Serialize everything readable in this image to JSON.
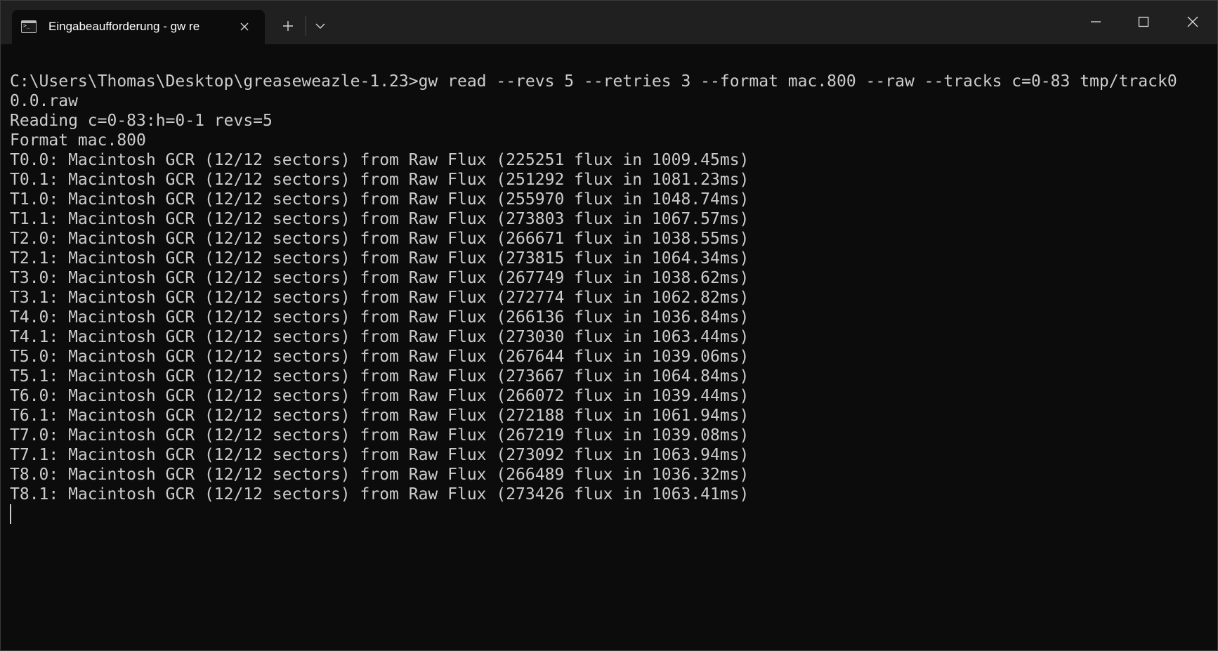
{
  "tab": {
    "title": "Eingabeaufforderung - gw  re",
    "icon": "command-prompt-icon",
    "close_icon": "close-icon"
  },
  "toolbar": {
    "new_tab_label": "+",
    "new_tab_icon": "plus-icon",
    "dropdown_icon": "chevron-down-icon"
  },
  "window_controls": {
    "minimize_icon": "minimize-icon",
    "maximize_icon": "maximize-icon",
    "close_icon": "close-icon"
  },
  "terminal": {
    "lines": [
      "C:\\Users\\Thomas\\Desktop\\greaseweazle-1.23>gw read --revs 5 --retries 3 --format mac.800 --raw --tracks c=0-83 tmp/track0",
      "0.0.raw",
      "Reading c=0-83:h=0-1 revs=5",
      "Format mac.800",
      "T0.0: Macintosh GCR (12/12 sectors) from Raw Flux (225251 flux in 1009.45ms)",
      "T0.1: Macintosh GCR (12/12 sectors) from Raw Flux (251292 flux in 1081.23ms)",
      "T1.0: Macintosh GCR (12/12 sectors) from Raw Flux (255970 flux in 1048.74ms)",
      "T1.1: Macintosh GCR (12/12 sectors) from Raw Flux (273803 flux in 1067.57ms)",
      "T2.0: Macintosh GCR (12/12 sectors) from Raw Flux (266671 flux in 1038.55ms)",
      "T2.1: Macintosh GCR (12/12 sectors) from Raw Flux (273815 flux in 1064.34ms)",
      "T3.0: Macintosh GCR (12/12 sectors) from Raw Flux (267749 flux in 1038.62ms)",
      "T3.1: Macintosh GCR (12/12 sectors) from Raw Flux (272774 flux in 1062.82ms)",
      "T4.0: Macintosh GCR (12/12 sectors) from Raw Flux (266136 flux in 1036.84ms)",
      "T4.1: Macintosh GCR (12/12 sectors) from Raw Flux (273030 flux in 1063.44ms)",
      "T5.0: Macintosh GCR (12/12 sectors) from Raw Flux (267644 flux in 1039.06ms)",
      "T5.1: Macintosh GCR (12/12 sectors) from Raw Flux (273667 flux in 1064.84ms)",
      "T6.0: Macintosh GCR (12/12 sectors) from Raw Flux (266072 flux in 1039.44ms)",
      "T6.1: Macintosh GCR (12/12 sectors) from Raw Flux (272188 flux in 1061.94ms)",
      "T7.0: Macintosh GCR (12/12 sectors) from Raw Flux (267219 flux in 1039.08ms)",
      "T7.1: Macintosh GCR (12/12 sectors) from Raw Flux (273092 flux in 1063.94ms)",
      "T8.0: Macintosh GCR (12/12 sectors) from Raw Flux (266489 flux in 1036.32ms)",
      "T8.1: Macintosh GCR (12/12 sectors) from Raw Flux (273426 flux in 1063.41ms)"
    ]
  },
  "colors": {
    "titlebar_bg": "#202020",
    "terminal_bg": "#0c0c0c",
    "terminal_fg": "#cccccc"
  }
}
